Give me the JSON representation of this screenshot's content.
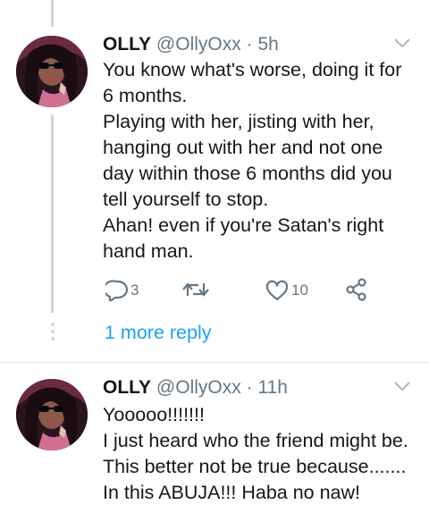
{
  "tweets": [
    {
      "name": "OLLY",
      "handle": "@OllyOxx",
      "dot": "·",
      "time": "5h",
      "lines": [
        "You know what's worse, doing it for",
        "6 months.",
        "Playing with her, jisting with her,",
        "hanging out with her and not one",
        "day within those 6 months did you",
        "tell yourself to stop.",
        "Ahan! even if you're Satan's right",
        "hand man."
      ],
      "actions": {
        "reply_count": "3",
        "like_count": "10"
      }
    },
    {
      "name": "OLLY",
      "handle": "@OllyOxx",
      "dot": "·",
      "time": "11h",
      "lines": [
        "Yooooo!!!!!!!",
        "I just heard who the friend might be.",
        "This better not be true because.......",
        "In this ABUJA!!! Haba no naw!"
      ]
    }
  ],
  "more_replies_label": "1 more reply",
  "icons": [
    "reply-icon",
    "retweet-icon",
    "like-icon",
    "share-icon",
    "chevron-down-icon"
  ],
  "colors": {
    "accent": "#1da1f2",
    "muted": "#657786",
    "thread_line": "#ccd6dd"
  }
}
